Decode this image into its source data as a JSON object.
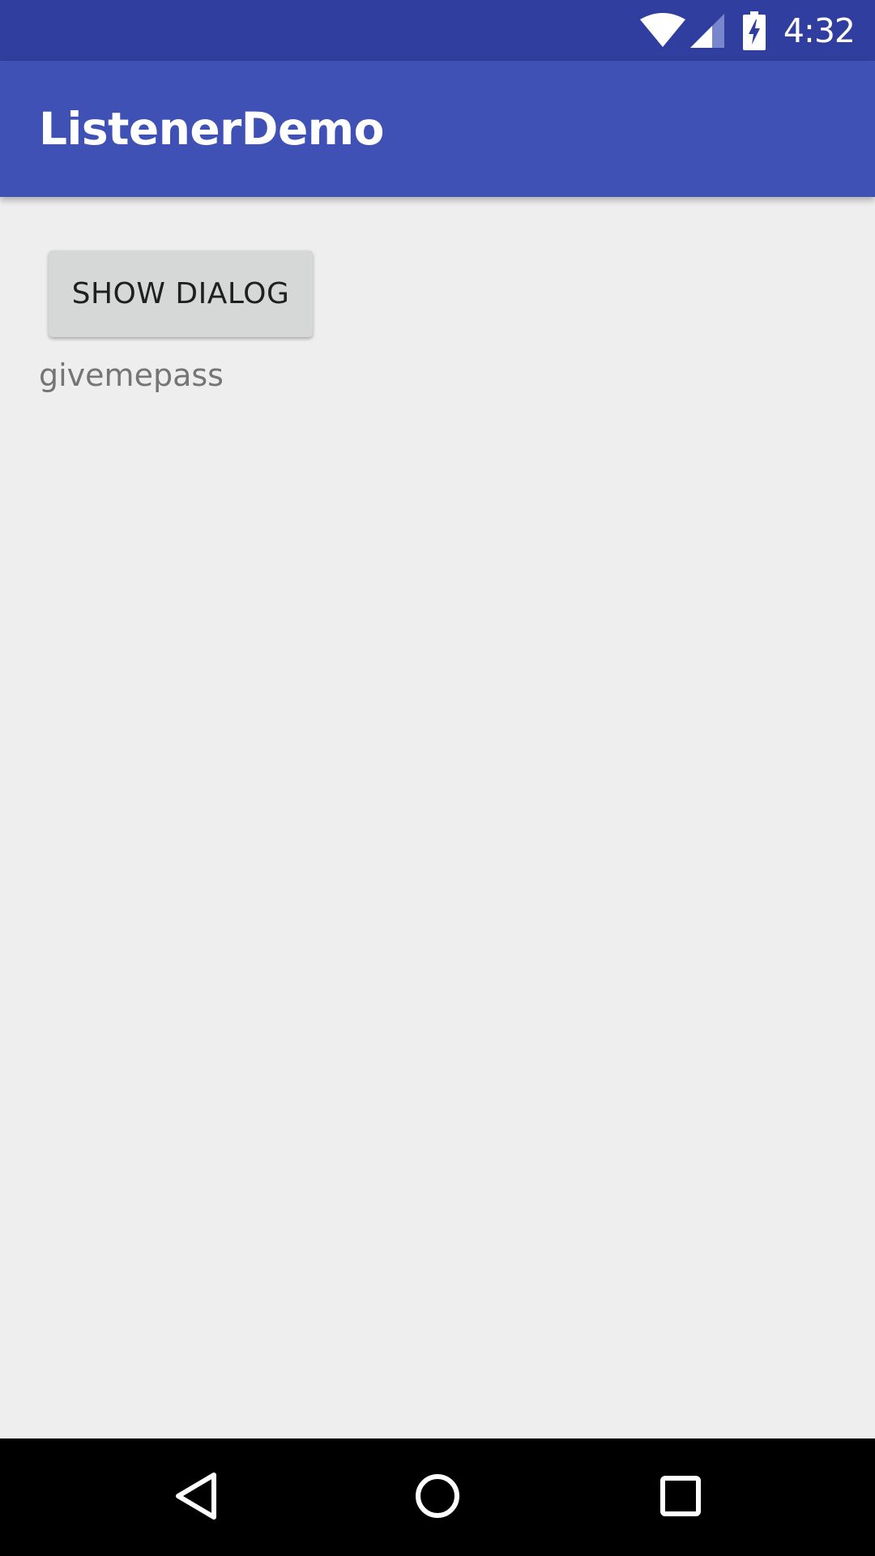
{
  "status_bar": {
    "time": "4:32",
    "icons": [
      "wifi-icon",
      "cell-signal-icon",
      "battery-charging-icon"
    ],
    "color": "#303F9F"
  },
  "app_bar": {
    "title": "ListenerDemo",
    "color": "#3F51B5"
  },
  "main": {
    "show_dialog_label": "SHOW DIALOG",
    "result_text": "givemepass"
  },
  "nav_bar": {
    "icons": [
      "back-icon",
      "home-icon",
      "recents-icon"
    ]
  }
}
